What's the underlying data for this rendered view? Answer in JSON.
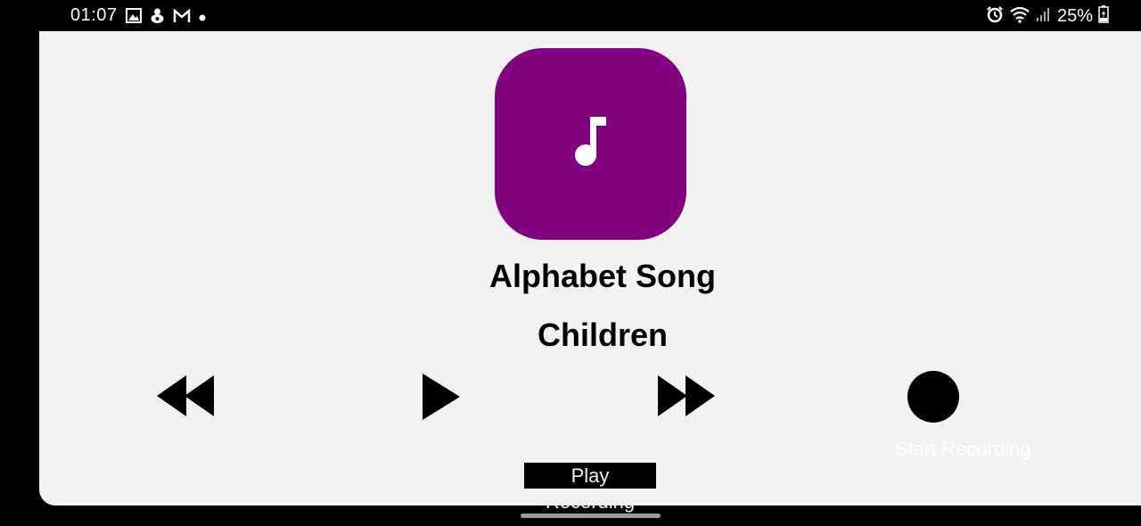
{
  "status_bar": {
    "time": "01:07",
    "battery": "25%",
    "left_icons": [
      "gallery-icon",
      "download-icon",
      "gmail-icon",
      "dot-icon"
    ],
    "right_icons": [
      "alarm-icon",
      "wifi-icon",
      "signal-icon",
      "battery-icon"
    ]
  },
  "player": {
    "album_icon": "music-note-icon",
    "album_color": "#800080",
    "song_title": "Alphabet Song",
    "artist": "Children",
    "controls": [
      "rewind-icon",
      "play-icon",
      "fast-forward-icon",
      "record-icon"
    ],
    "start_recording_label": "Start Recording",
    "play_recording_label": "Play Recording"
  }
}
